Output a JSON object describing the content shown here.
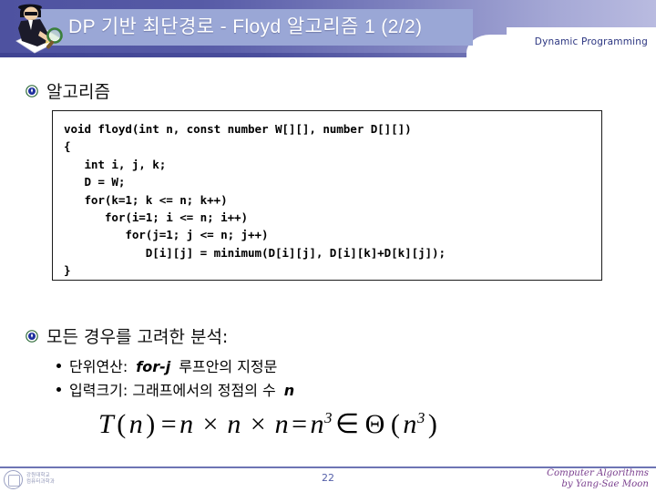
{
  "header": {
    "title": "DP 기반 최단경로 - Floyd 알고리즘 1 (2/2)",
    "subject": "Dynamic Programming",
    "mascot_icon": "detective-magnifier-icon"
  },
  "sections": {
    "algorithm_heading": "알고리즘",
    "analysis_heading": "모든 경우를 고려한 분석:"
  },
  "code": {
    "language": "c",
    "text": "void floyd(int n, const number W[][], number D[][])\n{\n   int i, j, k;\n   D = W;\n   for(k=1; k <= n; k++)\n      for(i=1; i <= n; i++)\n         for(j=1; j <= n; j++)\n            D[i][j] = minimum(D[i][j], D[i][k]+D[k][j]);\n}"
  },
  "bullets": [
    {
      "prefix": "단위연산:",
      "emphasis": "for-j",
      "suffix": "루프안의 지정문"
    },
    {
      "prefix": "입력크기: 그래프에서의 정점의 수",
      "emphasis": "n",
      "suffix": ""
    }
  ],
  "formula": {
    "lhs_fn": "T",
    "lhs_arg": "n",
    "terms": "n × n × n",
    "result_base": "n",
    "result_exp": "3",
    "member_symbol": "∈",
    "bound_symbol": "Θ",
    "bound_base": "n",
    "bound_exp": "3",
    "plain": "T(n) = n × n × n = n3 ∈ Θ(n3)"
  },
  "footer": {
    "page_number": "22",
    "credit_line1": "Computer Algorithms",
    "credit_line2": "by Yang-Sae Moon",
    "university_line1": "강원대학교",
    "university_line2": "컴퓨터과학과"
  },
  "colors": {
    "header_dark": "#4e52a0",
    "header_light": "#b9bbe0",
    "title_box": "#9aa7d6",
    "title_text": "#ffffff",
    "subject_text": "#2b3580",
    "footer_rule": "#6d74b4",
    "page_number": "#5560a8",
    "credit": "#7a3f8e"
  }
}
